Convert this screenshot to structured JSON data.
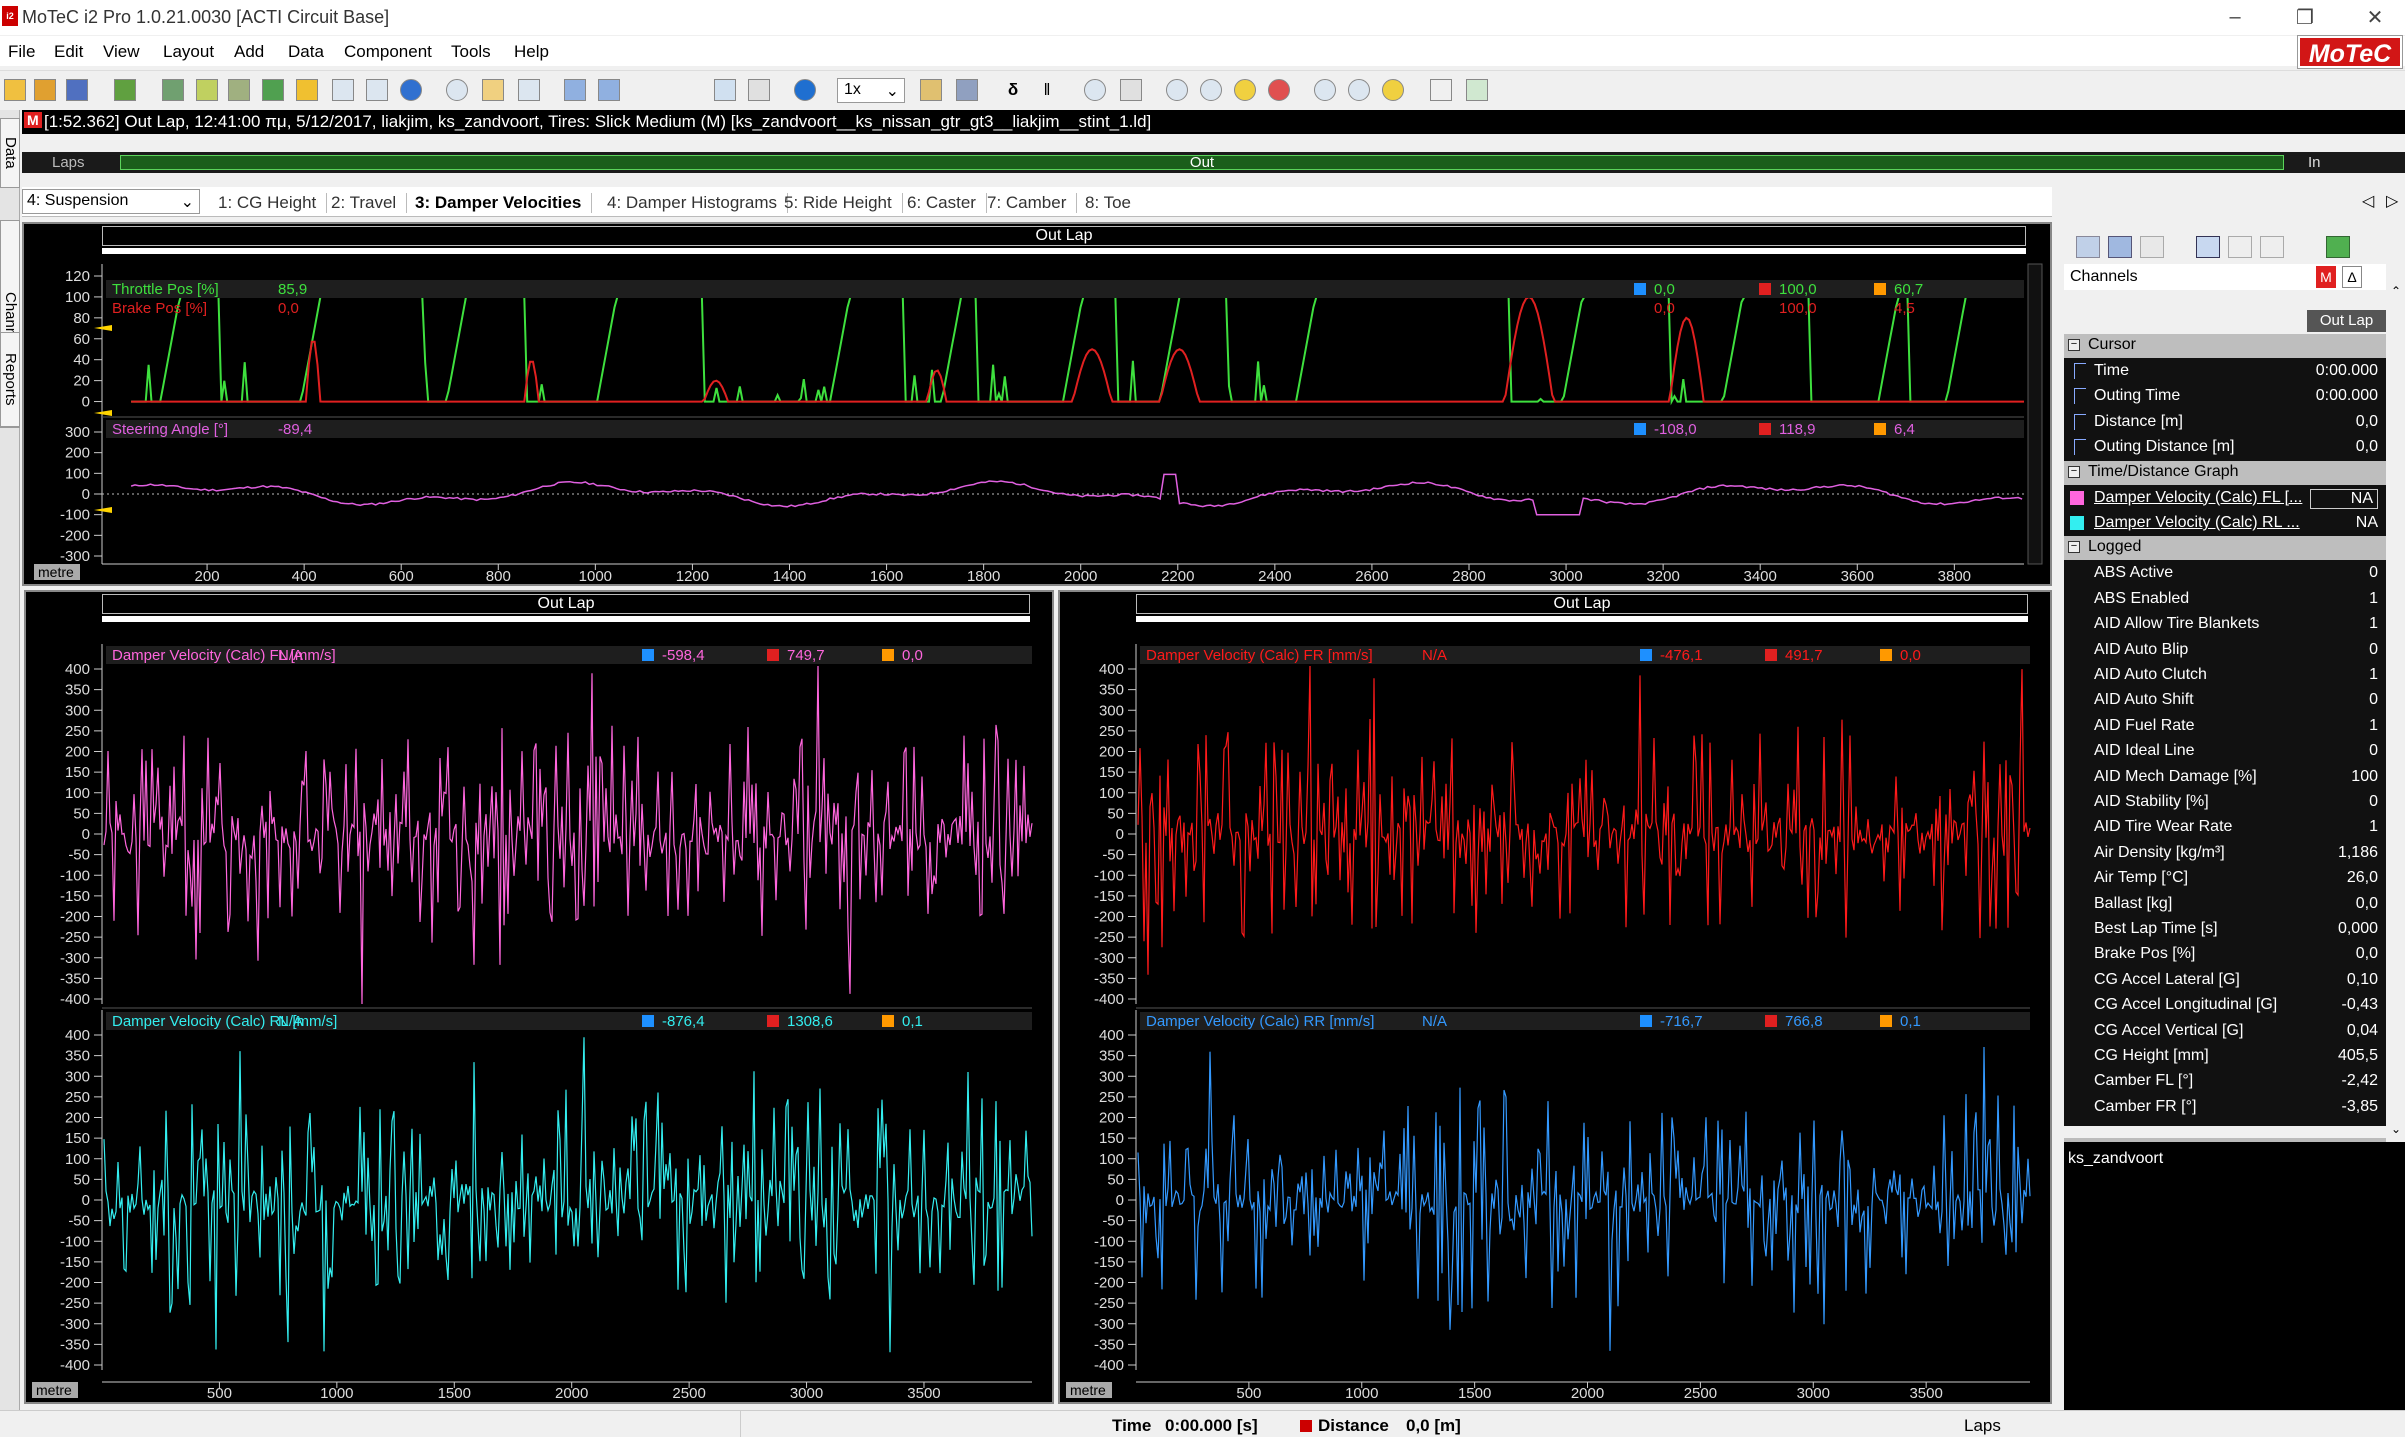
{
  "window": {
    "title": "MoTeC i2 Pro 1.0.21.0030  [ACTI Circuit Base]",
    "app_icon": "i2"
  },
  "menu": [
    "File",
    "Edit",
    "View",
    "Layout",
    "Add",
    "Data",
    "Component",
    "Tools",
    "Help"
  ],
  "brand": "MoTeC",
  "toolbar": {
    "speed": "1x"
  },
  "info": {
    "marker": "M",
    "text": "[1:52.362] Out Lap, 12:41:00 πμ, 5/12/2017, liakjim, ks_zandvoort, Tires: Slick Medium (M) [ks_zandvoort__ks_nissan_gtr_gt3__liakjim__stint_1.ld]"
  },
  "laps": {
    "label": "Laps",
    "out": "Out",
    "in": "In"
  },
  "side_tabs": [
    "Data",
    "Channels",
    "Reports"
  ],
  "worksheet": {
    "selector": "4: Suspension",
    "tabs": [
      "1: CG Height",
      "2: Travel",
      "3: Damper Velocities",
      "4: Damper Histograms",
      "5: Ride Height",
      "6: Caster",
      "7: Camber",
      "8: Toe"
    ],
    "active": 2
  },
  "graphs": {
    "top": {
      "title": "Out Lap",
      "unit": "metre",
      "xticks": [
        "200",
        "400",
        "600",
        "800",
        "1000",
        "1200",
        "1400",
        "1600",
        "1800",
        "2000",
        "2200",
        "2400",
        "2600",
        "2800",
        "3000",
        "3200",
        "3400",
        "3600",
        "3800"
      ],
      "pane1": {
        "yticks": [
          "120",
          "100",
          "80",
          "60",
          "40",
          "20",
          "0"
        ],
        "channels": [
          {
            "name": "Throttle Pos [%]",
            "value": "85,9",
            "min": "0,0",
            "max": "100,0",
            "avg": "60,7",
            "color": "#3ee03e"
          },
          {
            "name": "Brake Pos [%]",
            "value": "0,0",
            "min": "0,0",
            "max": "100,0",
            "avg": "4,5",
            "color": "#e02020"
          }
        ]
      },
      "pane2": {
        "yticks": [
          "300",
          "200",
          "100",
          "0",
          "-100",
          "-200",
          "-300"
        ],
        "channels": [
          {
            "name": "Steering Angle [°]",
            "value": "-89,4",
            "min": "-108,0",
            "max": "118,9",
            "avg": "6,4",
            "color": "#e060e0"
          }
        ]
      }
    },
    "fl": {
      "title": "Out Lap",
      "unit": "metre",
      "xticks": [
        "500",
        "1000",
        "1500",
        "2000",
        "2500",
        "3000",
        "3500"
      ],
      "yticks": [
        "400",
        "350",
        "300",
        "250",
        "200",
        "150",
        "100",
        "50",
        "0",
        "-50",
        "-100",
        "-150",
        "-200",
        "-250",
        "-300",
        "-350",
        "-400"
      ],
      "ch_top": {
        "name": "Damper Velocity (Calc) FL [mm/s]",
        "value": "N/A",
        "min": "-598,4",
        "max": "749,7",
        "avg": "0,0",
        "color": "#ff66dd"
      },
      "ch_bot": {
        "name": "Damper Velocity (Calc) RL [mm/s]",
        "value": "N/A",
        "min": "-876,4",
        "max": "1308,6",
        "avg": "0,1",
        "color": "#33eef0"
      }
    },
    "fr": {
      "title": "Out Lap",
      "unit": "metre",
      "xticks": [
        "500",
        "1000",
        "1500",
        "2000",
        "2500",
        "3000",
        "3500"
      ],
      "yticks": [
        "400",
        "350",
        "300",
        "250",
        "200",
        "150",
        "100",
        "50",
        "0",
        "-50",
        "-100",
        "-150",
        "-200",
        "-250",
        "-300",
        "-350",
        "-400"
      ],
      "ch_top": {
        "name": "Damper Velocity (Calc) FR [mm/s]",
        "value": "N/A",
        "min": "-476,1",
        "max": "491,7",
        "avg": "0,0",
        "color": "#ff1a1a"
      },
      "ch_bot": {
        "name": "Damper Velocity (Calc) RR [mm/s]",
        "value": "N/A",
        "min": "-716,7",
        "max": "766,8",
        "avg": "0,1",
        "color": "#3399ff"
      }
    }
  },
  "channels_panel": {
    "header": "Channels",
    "marker": "M",
    "delta": "Δ",
    "lap": "Out Lap",
    "sections": [
      {
        "title": "Cursor",
        "rows": [
          [
            "Time",
            "0:00.000"
          ],
          [
            "Outing Time",
            "0:00.000"
          ],
          [
            "Distance [m]",
            "0,0"
          ],
          [
            "Outing Distance [m]",
            "0,0"
          ]
        ]
      },
      {
        "title": "Time/Distance Graph",
        "rows": [
          [
            "Damper Velocity (Calc) FL [...",
            "NA"
          ],
          [
            "Damper Velocity (Calc) RL ...",
            "NA"
          ]
        ]
      },
      {
        "title": "Logged",
        "rows": [
          [
            "ABS Active",
            "0"
          ],
          [
            "ABS Enabled",
            "1"
          ],
          [
            "AID Allow Tire Blankets",
            "1"
          ],
          [
            "AID Auto Blip",
            "0"
          ],
          [
            "AID Auto Clutch",
            "1"
          ],
          [
            "AID Auto Shift",
            "0"
          ],
          [
            "AID Fuel Rate",
            "1"
          ],
          [
            "AID Ideal Line",
            "0"
          ],
          [
            "AID Mech Damage [%]",
            "100"
          ],
          [
            "AID Stability [%]",
            "0"
          ],
          [
            "AID Tire Wear Rate",
            "1"
          ],
          [
            "Air Density [kg/m³]",
            "1,186"
          ],
          [
            "Air Temp [°C]",
            "26,0"
          ],
          [
            "Ballast [kg]",
            "0,0"
          ],
          [
            "Best Lap Time [s]",
            "0,000"
          ],
          [
            "Brake Pos [%]",
            "0,0"
          ],
          [
            "CG Accel Lateral [G]",
            "0,10"
          ],
          [
            "CG Accel Longitudinal [G]",
            "-0,43"
          ],
          [
            "CG Accel Vertical [G]",
            "0,04"
          ],
          [
            "CG Height [mm]",
            "405,5"
          ],
          [
            "Camber FL [°]",
            "-2,42"
          ],
          [
            "Camber FR [°]",
            "-3,85"
          ]
        ]
      }
    ],
    "track": "ks_zandvoort"
  },
  "status": {
    "time_label": "Time",
    "time_value": "0:00.000 [s]",
    "dist_label": "Distance",
    "dist_value": "0,0 [m]",
    "right": "Laps"
  }
}
